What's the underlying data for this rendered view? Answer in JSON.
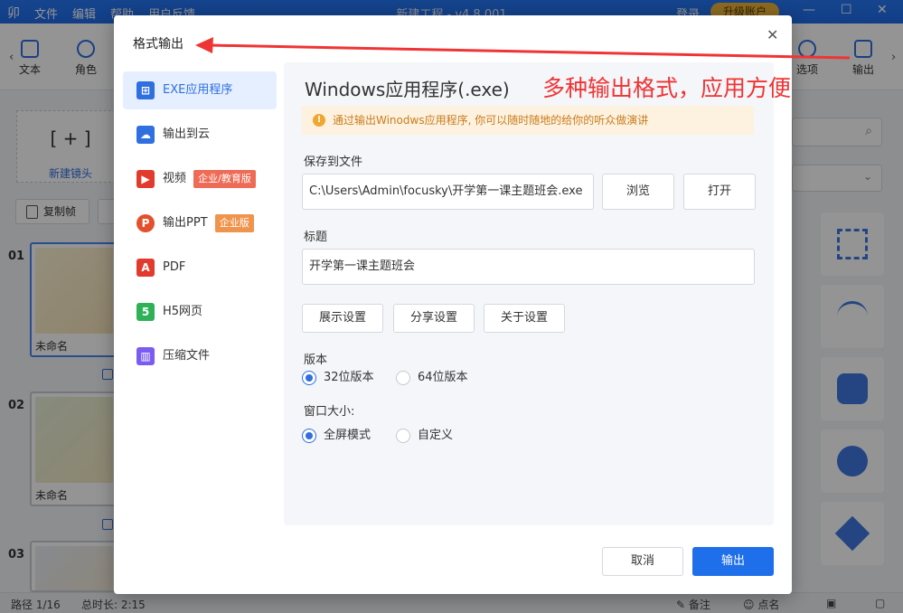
{
  "app": {
    "logo": "卯",
    "menu": [
      "文件",
      "编辑",
      "帮助",
      "用户反馈"
    ],
    "title": "新建工程 - v4.8.001",
    "login": "登录",
    "upgrade": "升级账户",
    "window_controls": [
      "minimize-icon",
      "maximize-icon",
      "close-icon"
    ]
  },
  "toolbar": {
    "items": [
      {
        "label": "文本",
        "icon": "text-icon"
      },
      {
        "label": "角色",
        "icon": "person-icon"
      },
      {
        "label": "选项",
        "icon": "hexagon-settings-icon"
      },
      {
        "label": "输出",
        "icon": "export-icon"
      }
    ]
  },
  "left": {
    "new_lens": "新建镜头",
    "copy_frame": "复制帧",
    "slides": [
      {
        "no": "01",
        "name": "未命名"
      },
      {
        "no": "02",
        "name": "未命名"
      },
      {
        "no": "03",
        "name": ""
      }
    ]
  },
  "status": {
    "path": "路径 1/16",
    "duration": "总时长: 2:15",
    "notes": "备注",
    "rollcall": "点名"
  },
  "dialog": {
    "title": "格式输出",
    "nav": [
      {
        "label": "EXE应用程序",
        "icon": "windows-icon",
        "color": "#2f6fe0",
        "tag": ""
      },
      {
        "label": "输出到云",
        "icon": "cloud-icon",
        "color": "#2f6fe0",
        "tag": ""
      },
      {
        "label": "视频",
        "icon": "video-icon",
        "color": "#e23b2e",
        "tag": "企业/教育版"
      },
      {
        "label": "输出PPT",
        "icon": "ppt-icon",
        "color": "#e4502b",
        "tag": "企业版"
      },
      {
        "label": "PDF",
        "icon": "pdf-icon",
        "color": "#e23b2e",
        "tag": ""
      },
      {
        "label": "H5网页",
        "icon": "html5-icon",
        "color": "#2fb257",
        "tag": ""
      },
      {
        "label": "压缩文件",
        "icon": "zip-icon",
        "color": "#7a5cf0",
        "tag": ""
      }
    ],
    "content_title": "Windows应用程序(.exe)",
    "notice": "通过输出Winodws应用程序, 你可以随时随地的给你的听众做演讲",
    "save_label": "保存到文件",
    "save_path": "C:\\Users\\Admin\\focusky\\开学第一课主题班会.exe",
    "browse": "浏览",
    "open": "打开",
    "title_label": "标题",
    "title_value": "开学第一课主题班会",
    "settings_buttons": [
      "展示设置",
      "分享设置",
      "关于设置"
    ],
    "version_label": "版本",
    "version_options": [
      "32位版本",
      "64位版本"
    ],
    "version_selected": "32位版本",
    "window_label": "窗口大小:",
    "window_options": [
      "全屏模式",
      "自定义"
    ],
    "window_selected": "全屏模式",
    "cancel": "取消",
    "export": "输出",
    "close_icon": "close-icon"
  },
  "annotation": {
    "text": "多种输出格式，应用方便",
    "color": "#f03434"
  }
}
